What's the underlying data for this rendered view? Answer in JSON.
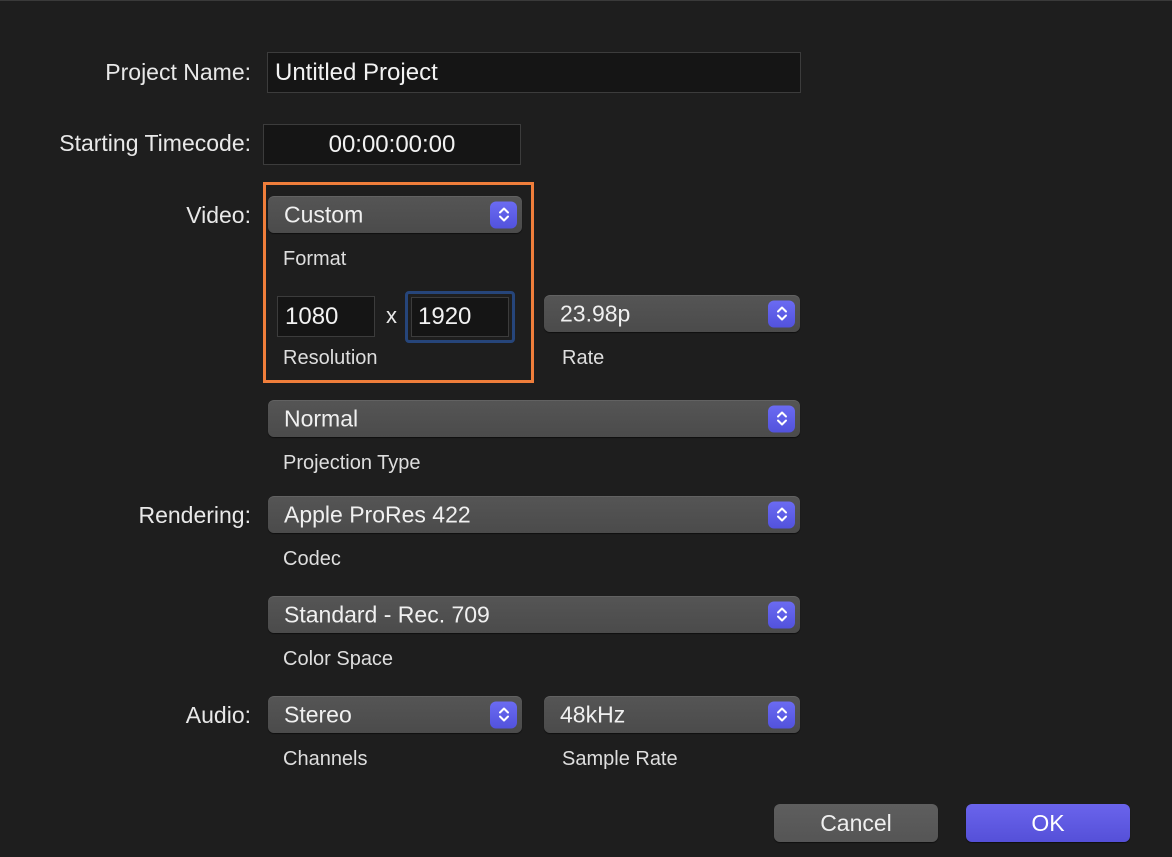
{
  "labels": {
    "project_name": "Project Name:",
    "starting_timecode": "Starting Timecode:",
    "video": "Video:",
    "rendering": "Rendering:",
    "audio": "Audio:"
  },
  "fields": {
    "project_name": "Untitled Project",
    "starting_timecode": "00:00:00:00",
    "resolution_width": "1080",
    "resolution_height": "1920",
    "resolution_separator": "x"
  },
  "popups": {
    "format": "Custom",
    "rate": "23.98p",
    "projection_type": "Normal",
    "codec": "Apple ProRes 422",
    "color_space": "Standard - Rec. 709",
    "channels": "Stereo",
    "sample_rate": "48kHz"
  },
  "sublabels": {
    "format": "Format",
    "resolution": "Resolution",
    "rate": "Rate",
    "projection_type": "Projection Type",
    "codec": "Codec",
    "color_space": "Color Space",
    "channels": "Channels",
    "sample_rate": "Sample Rate"
  },
  "buttons": {
    "cancel": "Cancel",
    "ok": "OK"
  },
  "icons": {
    "popup_stepper": "chevron-up-down-icon"
  },
  "colors": {
    "accent": "#5a55e0",
    "highlight": "#f07e3b",
    "focus_ring": "#26457a",
    "background": "#1e1e1e"
  }
}
